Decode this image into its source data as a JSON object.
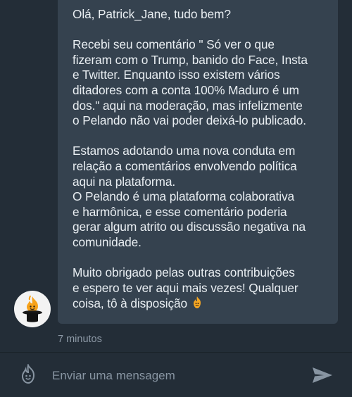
{
  "message": {
    "paragraphs": [
      [
        "Olá, Patrick_Jane, tudo bem?"
      ],
      [
        "Recebi seu comentário \" Só ver o que",
        "fizeram com o Trump, banido do Face, Insta",
        "e Twitter. Enquanto isso existem vários",
        "ditadores com a conta 100% Maduro é um",
        "dos.\" aqui na moderação, mas infelizmente",
        "o Pelando não vai poder deixá-lo publicado."
      ],
      [
        "Estamos adotando uma nova conduta em",
        "relação a comentários envolvendo política",
        "aqui na plataforma.",
        "O Pelando é uma plataforma colaborativa",
        "e harmônica, e esse comentário poderia",
        "gerar algum atrito ou discussão negativa na",
        "comunidade."
      ],
      [
        "Muito obrigado pelas outras contribuições",
        "e espero te ver aqui mais vezes! Qualquer",
        "coisa, tô à disposição"
      ]
    ],
    "inline_icon": "flame-smile-icon",
    "timestamp": "7 minutos"
  },
  "composer": {
    "placeholder": "Enviar uma mensagem",
    "emoji_icon": "flame-smile-icon",
    "send_icon": "send-icon"
  },
  "avatar": {
    "icon": "pelando-mascot-top-hat-icon"
  },
  "colors": {
    "background": "#232d37",
    "bubble": "#35424f",
    "text": "#e9eef2",
    "muted": "#8d99a6",
    "accent": "#f5a623"
  }
}
